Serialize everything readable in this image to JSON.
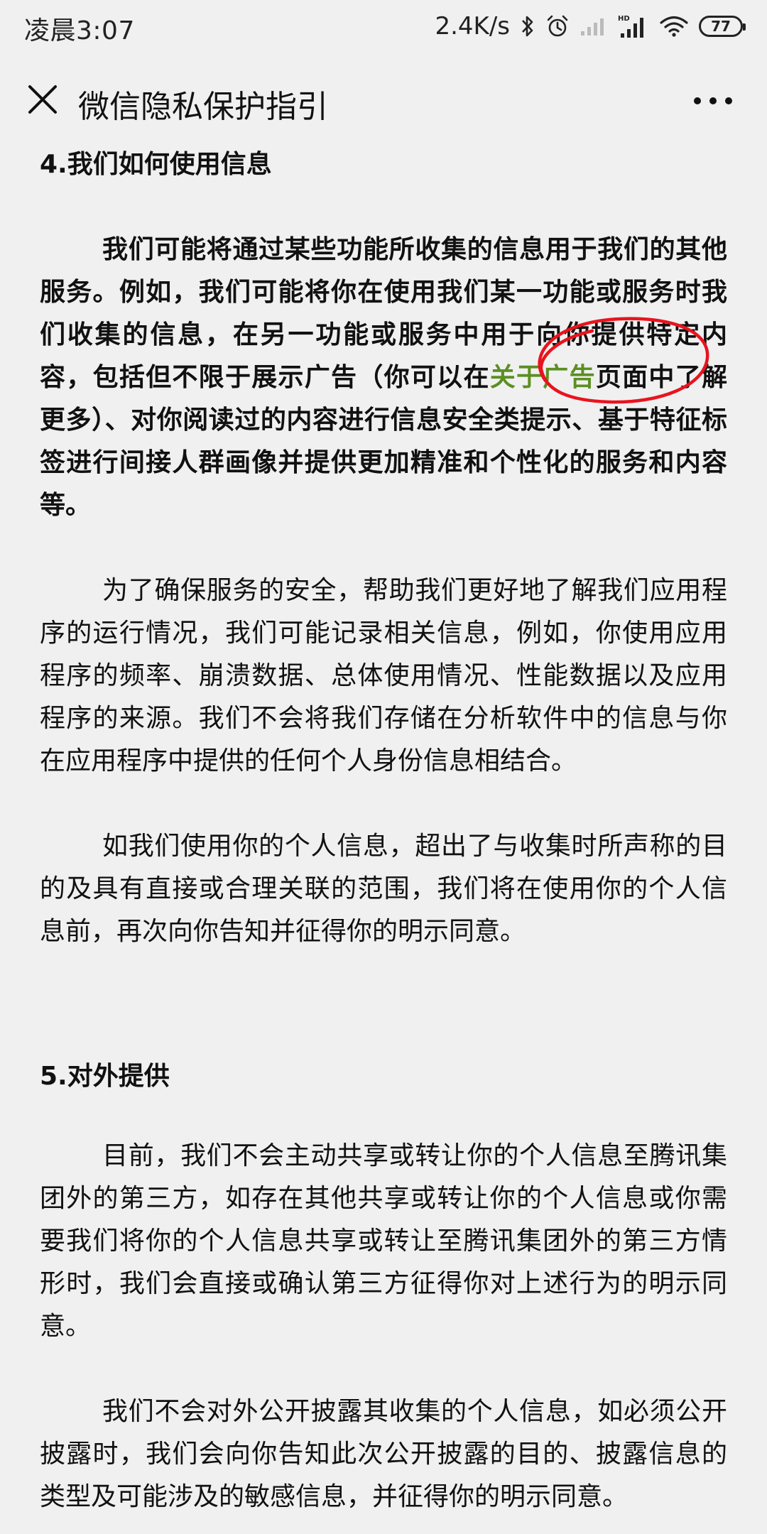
{
  "status_bar": {
    "time": "凌晨3:07",
    "net_speed": "2.4K/s",
    "battery": "77",
    "icons": [
      "bluetooth-icon",
      "alarm-icon",
      "signal-weak-icon",
      "hd-signal-icon",
      "wifi-icon",
      "battery-icon"
    ]
  },
  "nav": {
    "title": "微信隐私保护指引",
    "close_icon": "close-icon",
    "more_icon": "more-icon"
  },
  "section4": {
    "title": "4.我们如何使用信息",
    "p1_before": "我们可能将通过某些功能所收集的信息用于我们的其他服务。例如，我们可能将你在使用我们某一功能或服务时我们收集的信息，在另一功能或服务中用于向你提供特定内容，包括但不限于展示广告（你可以在",
    "p1_link": "关于广告",
    "p1_after": "页面中了解更多）、对你阅读过的内容进行信息安全类提示、基于特征标签进行间接人群画像并提供更加精准和个性化的服务和内容等。",
    "p2": "为了确保服务的安全，帮助我们更好地了解我们应用程序的运行情况，我们可能记录相关信息，例如，你使用应用程序的频率、崩溃数据、总体使用情况、性能数据以及应用程序的来源。我们不会将我们存储在分析软件中的信息与你在应用程序中提供的任何个人身份信息相结合。",
    "p3": "如我们使用你的个人信息，超出了与收集时所声称的目的及具有直接或合理关联的范围，我们将在使用你的个人信息前，再次向你告知并征得你的明示同意。"
  },
  "section5": {
    "title": "5.对外提供",
    "p1": "目前，我们不会主动共享或转让你的个人信息至腾讯集团外的第三方，如存在其他共享或转让你的个人信息或你需要我们将你的个人信息共享或转让至腾讯集团外的第三方情形时，我们会直接或确认第三方征得你对上述行为的明示同意。",
    "p2": "我们不会对外公开披露其收集的个人信息，如必须公开披露时，我们会向你告知此次公开披露的目的、披露信息的类型及可能涉及的敏感信息，并征得你的明示同意。"
  },
  "colors": {
    "background": "#f0f0f0",
    "text": "#111111",
    "link": "#5b8f22",
    "annotation": "#e8141e"
  }
}
